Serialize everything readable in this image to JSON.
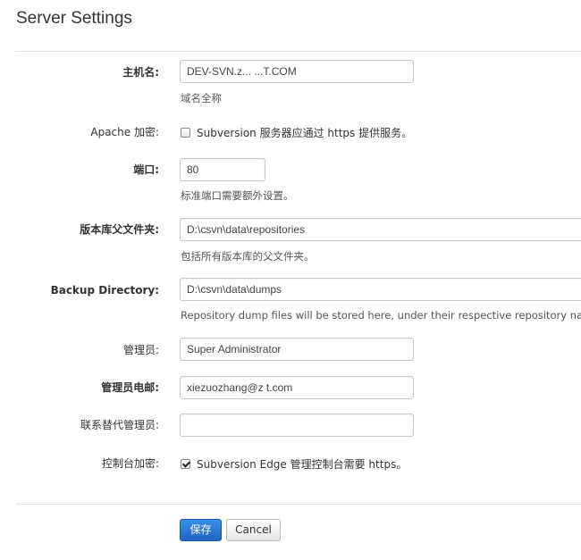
{
  "page": {
    "title": "Server Settings"
  },
  "form": {
    "hostname": {
      "label": "主机名:",
      "value": "DEV-SVN.z... ...T.COM",
      "help": "域名全称"
    },
    "apache_ssl": {
      "label": "Apache 加密:",
      "text": "Subversion 服务器应通过 https 提供服务。",
      "checked": false
    },
    "port": {
      "label": "端口:",
      "value": "80",
      "help": "标准端口需要额外设置。"
    },
    "repo_parent": {
      "label": "版本库父文件夹:",
      "value": "D:\\csvn\\data\\repositories",
      "help": "包括所有版本库的父文件夹。"
    },
    "backup_dir": {
      "label": "Backup Directory:",
      "value": "D:\\csvn\\data\\dumps",
      "help": "Repository dump files will be stored here, under their respective repository name."
    },
    "admin": {
      "label": "管理员:",
      "value": "Super Administrator"
    },
    "admin_email": {
      "label": "管理员电邮:",
      "value": "xiezuozhang@z      t.com"
    },
    "alt_admin": {
      "label": "联系替代管理员:",
      "value": ""
    },
    "console_ssl": {
      "label": "控制台加密:",
      "text": "Subversion Edge 管理控制台需要 https。",
      "checked": true
    }
  },
  "buttons": {
    "save": "保存",
    "cancel": "Cancel"
  },
  "colors": {
    "primary": "#2574d4",
    "border": "#c8c8c8"
  }
}
